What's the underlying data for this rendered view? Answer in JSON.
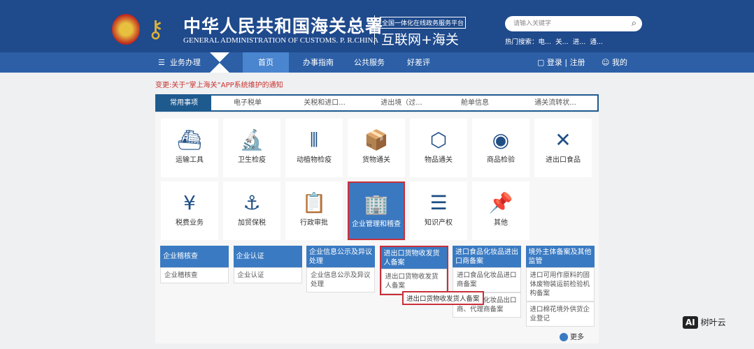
{
  "header": {
    "title_cn": "中华人民共和国海关总署",
    "title_en": "GENERAL ADMINISTRATION OF CUSTOMS. P. R.CHINA",
    "platform": "全国一体化在线政务服务平台",
    "platform_name": "互联网+海关",
    "search_placeholder": "请输入关键字",
    "hot_label": "热门搜索：",
    "hot_items": [
      "电...",
      "关...",
      "进...",
      "通..."
    ]
  },
  "nav": {
    "menu": "业务办理",
    "items": [
      "首页",
      "办事指南",
      "公共服务",
      "好差评"
    ],
    "login": "登录",
    "register": "注册",
    "mine": "我的",
    "sep": "|"
  },
  "notice": "变更:关于“掌上海关”APP系统维护的通知",
  "tabs": [
    "常用事项",
    "电子税单",
    "关税和进口...",
    "进出境（过...",
    "舱单信息",
    "通关流转状..."
  ],
  "tiles": [
    {
      "label": "运输工具",
      "icon": "ship-icon",
      "glyph": "⛴"
    },
    {
      "label": "卫生检疫",
      "icon": "microscope-icon",
      "glyph": "🔬"
    },
    {
      "label": "动植物检疫",
      "icon": "test-tubes-icon",
      "glyph": "⫴"
    },
    {
      "label": "货物通关",
      "icon": "package-icon",
      "glyph": "📦"
    },
    {
      "label": "物品通关",
      "icon": "box-icon",
      "glyph": "⬡"
    },
    {
      "label": "商品检验",
      "icon": "eye-icon",
      "glyph": "◉"
    },
    {
      "label": "进出口食品",
      "icon": "utensils-icon",
      "glyph": "✕"
    },
    {
      "label": "税费业务",
      "icon": "yen-icon",
      "glyph": "¥"
    },
    {
      "label": "加贸保税",
      "icon": "anchor-icon",
      "glyph": "⚓"
    },
    {
      "label": "行政审批",
      "icon": "document-stamp-icon",
      "glyph": "📋"
    },
    {
      "label": "企业管理和稽查",
      "icon": "building-icon",
      "glyph": "🏢"
    },
    {
      "label": "知识产权",
      "icon": "layers-icon",
      "glyph": "☰"
    },
    {
      "label": "其他",
      "icon": "pin-icon",
      "glyph": "📌"
    }
  ],
  "columns": [
    {
      "header": "企业稽核查",
      "items": [
        "企业稽核查"
      ]
    },
    {
      "header": "企业认证",
      "items": [
        "企业认证"
      ]
    },
    {
      "header": "企业信息公示及异议处理",
      "items": [
        "企业信息公示及异议处理"
      ]
    },
    {
      "header": "进出口货物收发货人备案",
      "items": [
        "进出口货物收发货人备案"
      ]
    },
    {
      "header": "进口食品化妆品进出口商备案",
      "items": [
        "进口食品化妆品进口商备案",
        "进口食品化妆品出口商、代理商备案"
      ]
    },
    {
      "header": "境外主体备案及其他监管",
      "items": [
        "进口可用作原料的固体废物装运前检验机构备案",
        "进口棉花境外供货企业登记"
      ]
    }
  ],
  "tooltip": "进出口货物收发货人备案",
  "more": "更多",
  "watermark": "树叶云",
  "watermark_logo": "AI"
}
